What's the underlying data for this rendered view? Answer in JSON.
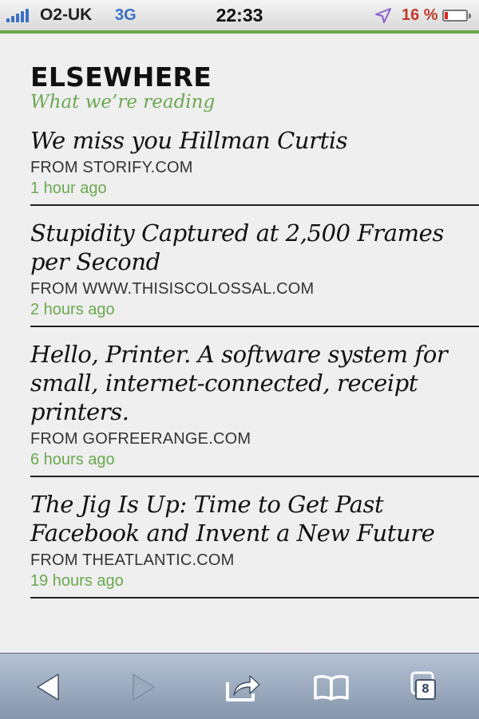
{
  "status_bar": {
    "carrier": "O2-UK",
    "network": "3G",
    "time": "22:33",
    "battery_percent": "16 %",
    "battery_level": 0.16,
    "icons": [
      "signal-icon",
      "location-arrow-icon",
      "battery-icon"
    ]
  },
  "section": {
    "title": "ELSEWHERE",
    "subtitle": "What we’re reading"
  },
  "articles": [
    {
      "title": "We miss you Hillman Curtis",
      "source": "FROM STORIFY.COM",
      "time": "1 hour ago"
    },
    {
      "title": "Stupidity Captured at 2,500 Frames per Second",
      "source": "FROM WWW.THISISCOLOSSAL.COM",
      "time": "2 hours ago"
    },
    {
      "title": "Hello, Printer. A software system for small, internet-connected, receipt printers.",
      "source": "FROM GOFREERANGE.COM",
      "time": "6 hours ago"
    },
    {
      "title": "The Jig Is Up: Time to Get Past Facebook and Invent a New Future",
      "source": "FROM THEATLANTIC.COM",
      "time": "19 hours ago"
    }
  ],
  "toolbar": {
    "tabs_count": "8",
    "icons": [
      "back-arrow-icon",
      "forward-arrow-icon",
      "share-icon",
      "bookmarks-icon",
      "tabs-icon"
    ]
  },
  "colors": {
    "accent_green": "#6aa84f",
    "signal_blue": "#3a6fc4",
    "battery_red": "#c0392b",
    "toolbar_blue": "#8596ad"
  }
}
